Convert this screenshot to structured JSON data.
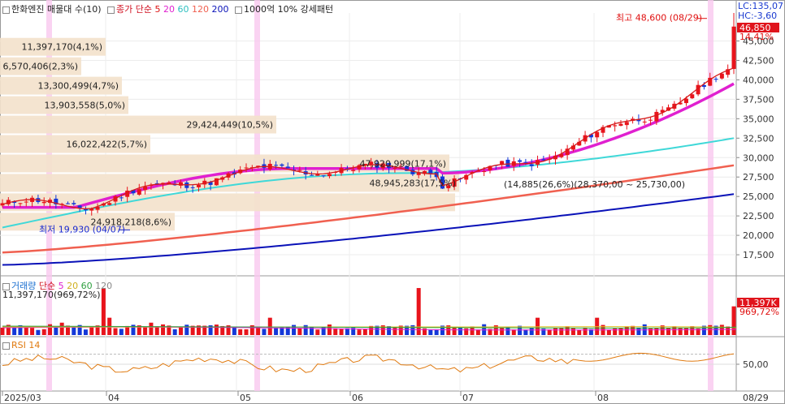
{
  "header": {
    "title": "한화엔진 매물대 수(10)",
    "ma_prefix": "종가 단순",
    "ma_periods": [
      "5",
      "20",
      "60",
      "120",
      "200"
    ],
    "ma_colors": [
      "#dd1111",
      "#e020d0",
      "#2fd0d0",
      "#f06050",
      "#0a12b8"
    ],
    "extra": "1000억 10% 강세패턴"
  },
  "price_panel": {
    "right_top_labels": [
      "LC:135,07",
      "HC:-3,60"
    ],
    "current_price": "46,850",
    "current_pct": "14,41%",
    "high_label": "최고 48,600 (08/29)",
    "low_label": "최저 19,930 (04/07)",
    "ticks": [
      "45,000",
      "42,500",
      "40,000",
      "37,500",
      "35,000",
      "32,500",
      "30,000",
      "27,500",
      "25,000",
      "22,500",
      "20,000",
      "17,500"
    ],
    "support_label": "(14,885(26,6%)(28,370,00 ~ 25,730,00)"
  },
  "volume_profile": [
    {
      "label": "11,397,170(4,1%)",
      "price": 44250,
      "width": 130
    },
    {
      "label": "6,570,406(2,3%)",
      "price": 41750,
      "width": 100
    },
    {
      "label": "13,300,499(4,7%)",
      "price": 39250,
      "width": 150
    },
    {
      "label": "13,903,558(5,0%)",
      "price": 36750,
      "width": 158
    },
    {
      "label": "29,424,449(10,5%)",
      "price": 34250,
      "width": 340
    },
    {
      "label": "16,022,422(5,7%)",
      "price": 31750,
      "width": 185
    },
    {
      "label": "47,920,999(17,1%)",
      "price": 29250,
      "width": 553
    },
    {
      "label": "48,945,283(17,5%)",
      "price": 26750,
      "width": 565
    },
    {
      "label": "14,885(26,6%)",
      "price": 24250,
      "width": 560
    },
    {
      "label": "24,918,218(8,6%)",
      "price": 21750,
      "width": 215
    }
  ],
  "volume_panel": {
    "title": "거래량",
    "ma_prefix": "단순",
    "ma_periods": [
      "5",
      "20",
      "60",
      "120"
    ],
    "ma_colors": [
      "#e020d0",
      "#e0c020",
      "#2fa040",
      "#888888"
    ],
    "value_label": "11,397,170(969,72%)",
    "right_value": "11,397K",
    "right_pct": "969,72%"
  },
  "rsi_panel": {
    "title": "RSI 14",
    "tick": "50,00"
  },
  "x_axis": {
    "labels": [
      "2025/03",
      "04",
      "05",
      "06",
      "07",
      "08",
      "08/29"
    ]
  },
  "chart_data": {
    "type": "candlestick",
    "x_range": [
      "2025-03",
      "2025-08-29"
    ],
    "y_range": [
      15000,
      48600
    ],
    "last_close": 46850,
    "last_change_pct": 14.41,
    "high": {
      "value": 48600,
      "date": "08/29"
    },
    "low": {
      "value": 19930,
      "date": "04/07"
    },
    "ma_series": [
      {
        "name": "5",
        "start": 23500,
        "end": 41000
      },
      {
        "name": "20",
        "start": 23600,
        "end": 39500
      },
      {
        "name": "60",
        "start": 21000,
        "end": 32500
      },
      {
        "name": "120",
        "start": 17800,
        "end": 29000
      },
      {
        "name": "200",
        "start": 16200,
        "end": 25300
      }
    ],
    "last_volume": 11397170,
    "last_volume_ratio_pct": 969.72,
    "rsi_reference": 50
  }
}
